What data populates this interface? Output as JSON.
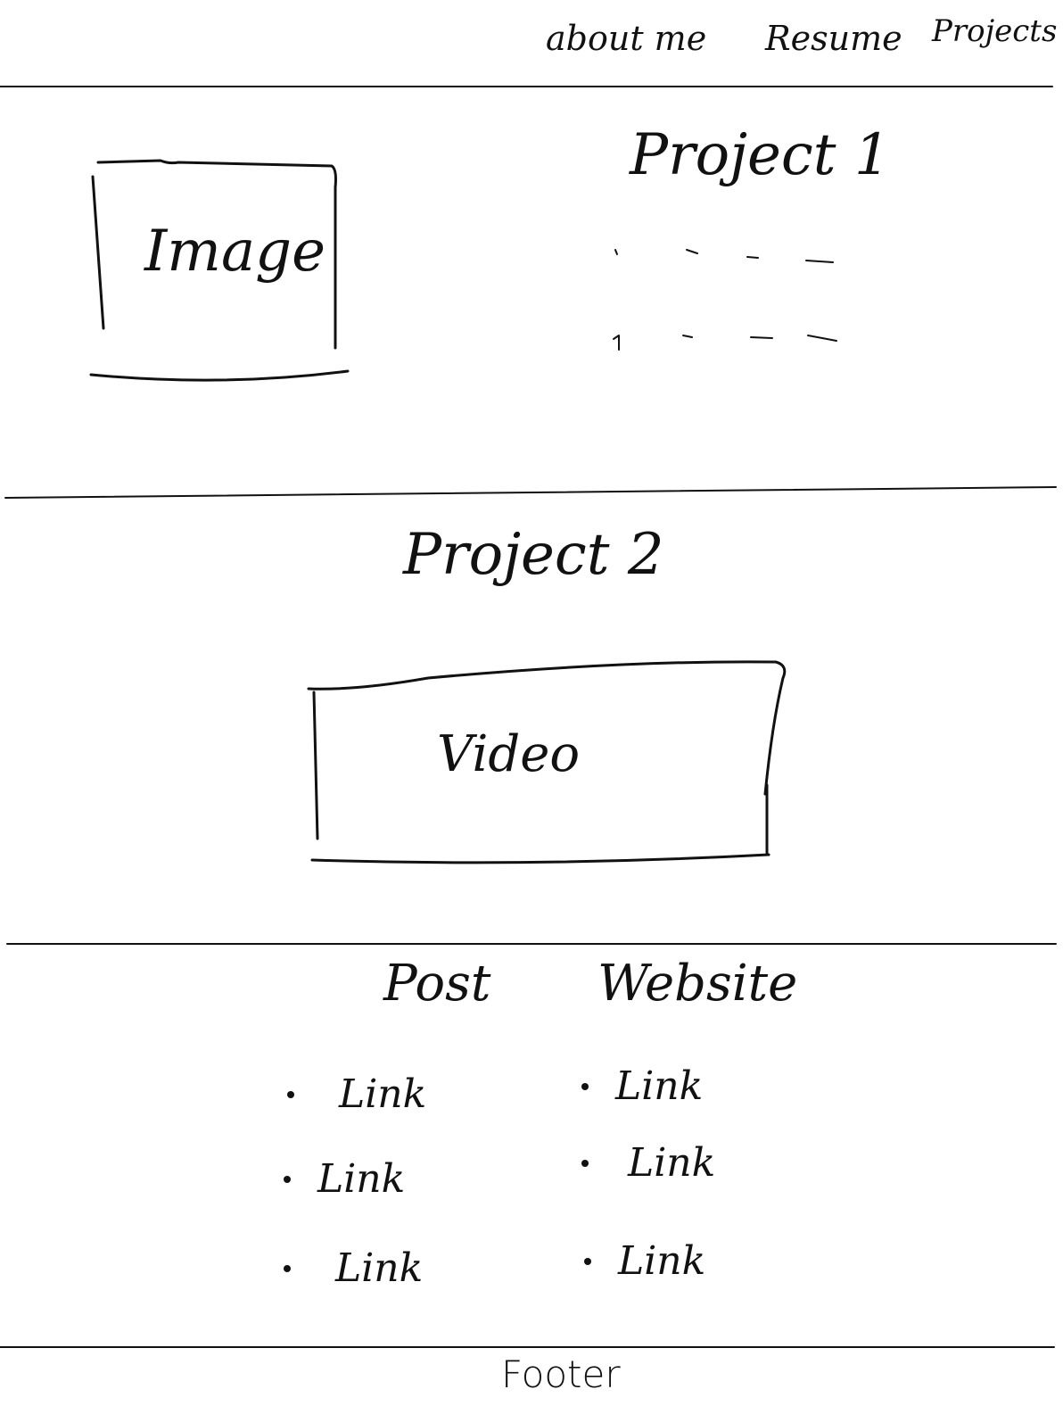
{
  "nav": {
    "items": [
      "about me",
      "Resume",
      "Projects"
    ]
  },
  "project1": {
    "title": "Project 1",
    "image_label": "Image"
  },
  "project2": {
    "title": "Project 2",
    "video_label": "Video"
  },
  "links": {
    "left_title": "Post",
    "right_title": "Website",
    "left_items": [
      "Link",
      "Link",
      "Link"
    ],
    "right_items": [
      "Link",
      "Link",
      "Link"
    ]
  },
  "footer": {
    "text": "Footer"
  }
}
